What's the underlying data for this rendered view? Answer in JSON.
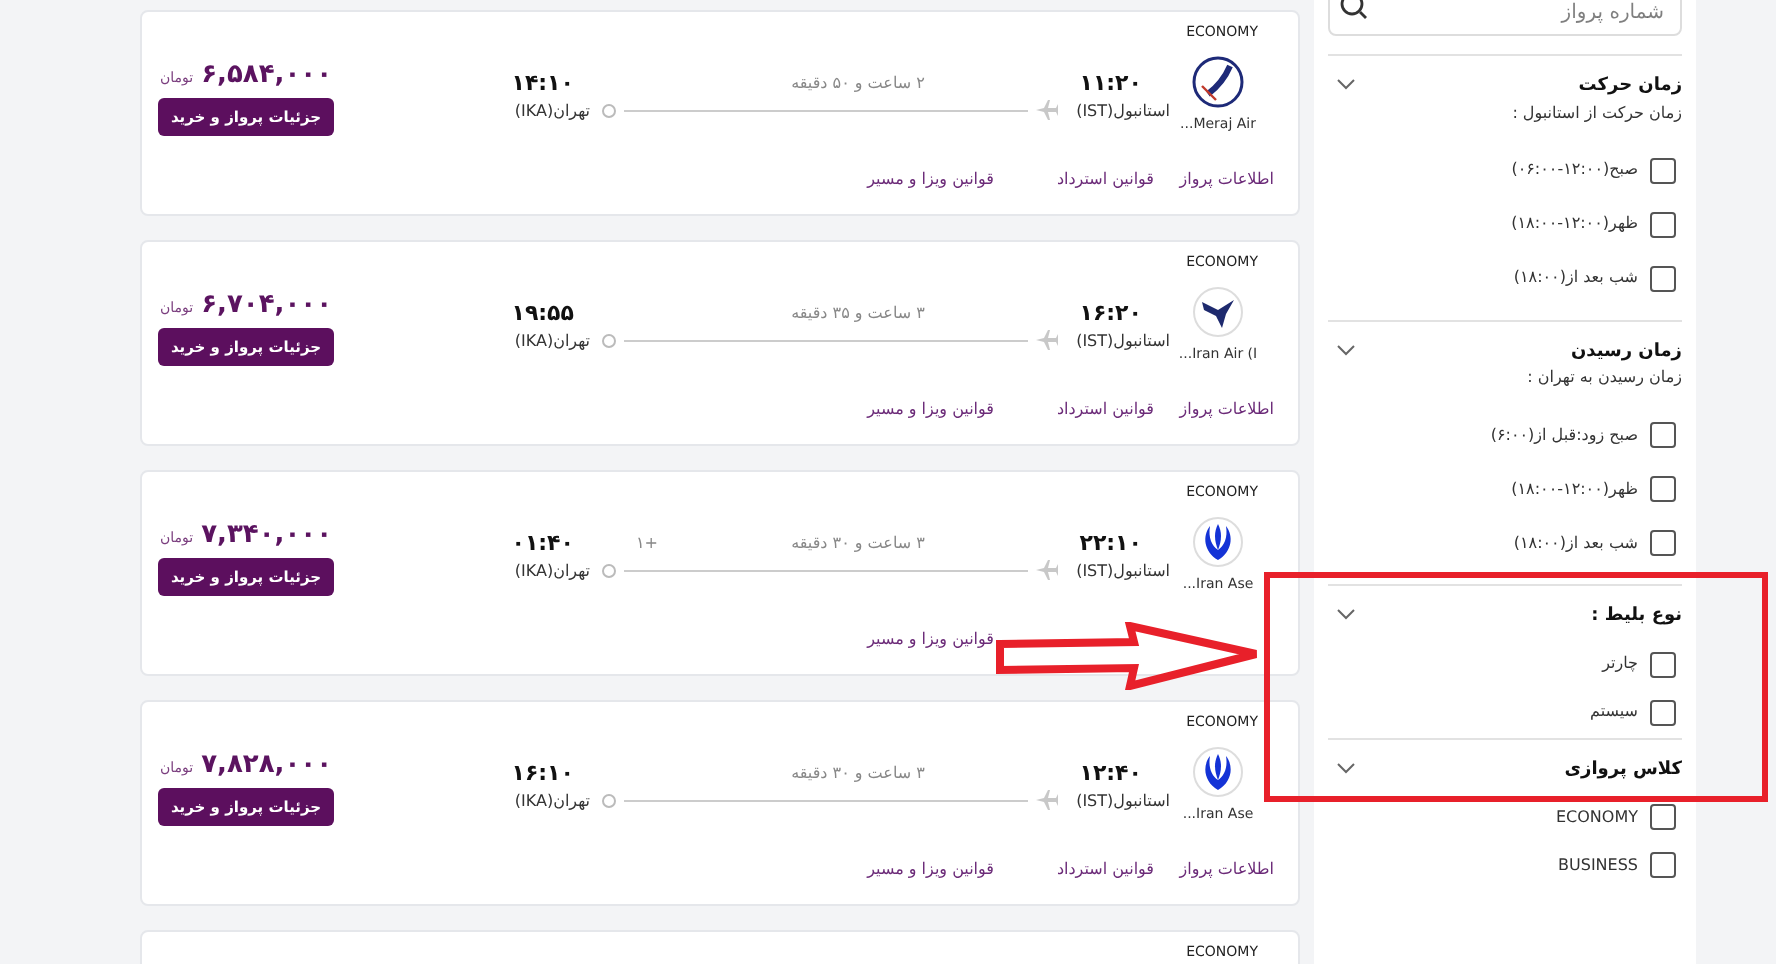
{
  "flights": [
    {
      "cabin": "ECONOMY",
      "kind": "meraj",
      "airline": "Meraj Air...",
      "depart_time": "۱۱:۲۰",
      "depart_airport": "استانبول(IST)",
      "duration": "۲ ساعت و ۵۰ دقیقه",
      "arrive_time": "۱۴:۱۰",
      "arrive_airport": "تهران(IKA)",
      "price": "۶,۵۸۴,۰۰۰",
      "currency": "تومان",
      "button": "جزئیات پرواز و خرید",
      "links": [
        {
          "kind": "info",
          "label": "اطلاعات پرواز"
        },
        {
          "kind": "refund",
          "label": "قوانین استرداد"
        },
        {
          "kind": "visa",
          "label": "قوانین ویزا و مسیر"
        }
      ]
    },
    {
      "cabin": "ECONOMY",
      "kind": "iranair",
      "airline": "Iran Air (I...",
      "depart_time": "۱۶:۲۰",
      "depart_airport": "استانبول(IST)",
      "duration": "۳ ساعت و ۳۵ دقیقه",
      "arrive_time": "۱۹:۵۵",
      "arrive_airport": "تهران(IKA)",
      "price": "۶,۷۰۴,۰۰۰",
      "currency": "تومان",
      "button": "جزئیات پرواز و خرید",
      "links": [
        {
          "kind": "info",
          "label": "اطلاعات پرواز"
        },
        {
          "kind": "refund",
          "label": "قوانین استرداد"
        },
        {
          "kind": "visa",
          "label": "قوانین ویزا و مسیر"
        }
      ]
    },
    {
      "cabin": "ECONOMY",
      "kind": "aseman",
      "airline": "Iran Ase...",
      "depart_time": "۲۲:۱۰",
      "depart_airport": "استانبول(IST)",
      "duration": "۳ ساعت و ۳۰ دقیقه",
      "next_day": "+۱",
      "arrive_time": "۰۱:۴۰",
      "arrive_airport": "تهران(IKA)",
      "price": "۷,۳۴۰,۰۰۰",
      "currency": "تومان",
      "button": "جزئیات پرواز و خرید",
      "links": [
        {
          "kind": "visa",
          "label": "قوانین ویزا و مسیر"
        }
      ]
    },
    {
      "cabin": "ECONOMY",
      "kind": "aseman",
      "airline": "Iran Ase...",
      "depart_time": "۱۲:۴۰",
      "depart_airport": "استانبول(IST)",
      "duration": "۳ ساعت و ۳۰ دقیقه",
      "arrive_time": "۱۶:۱۰",
      "arrive_airport": "تهران(IKA)",
      "price": "۷,۸۲۸,۰۰۰",
      "currency": "تومان",
      "button": "جزئیات پرواز و خرید",
      "links": [
        {
          "kind": "info",
          "label": "اطلاعات پرواز"
        },
        {
          "kind": "refund",
          "label": "قوانین استرداد"
        },
        {
          "kind": "visa",
          "label": "قوانین ویزا و مسیر"
        }
      ]
    },
    {
      "cabin": "ECONOMY"
    }
  ],
  "sidebar": {
    "search": {
      "placeholder": "شماره پرواز"
    },
    "sections": [
      {
        "title": "زمان حرکت",
        "subtitle": "زمان حرکت از استانبول :",
        "options": [
          {
            "label": "صبح(۱۲:۰۰-۰۶:۰۰)",
            "checked": false
          },
          {
            "label": "ظهر(۱۲:۰۰-۱۸:۰۰)",
            "checked": false
          },
          {
            "label": "شب بعد از(۱۸:۰۰)",
            "checked": false
          }
        ]
      },
      {
        "title": "زمان رسیدن",
        "subtitle": "زمان رسیدن به تهران :",
        "options": [
          {
            "label": "صبح زود:قبل از(۶:۰۰)",
            "checked": false
          },
          {
            "label": "ظهر(۱۲:۰۰-۱۸:۰۰)",
            "checked": false
          },
          {
            "label": "شب بعد از(۱۸:۰۰)",
            "checked": false
          }
        ]
      },
      {
        "title": "نوع بلیط :",
        "options": [
          {
            "label": "چارتر",
            "checked": false
          },
          {
            "label": "سیستم",
            "checked": false
          }
        ]
      },
      {
        "title": "کلاس پروازی",
        "options": [
          {
            "label": "ECONOMY",
            "checked": false
          },
          {
            "label": "BUSINESS",
            "checked": false
          }
        ]
      }
    ]
  }
}
